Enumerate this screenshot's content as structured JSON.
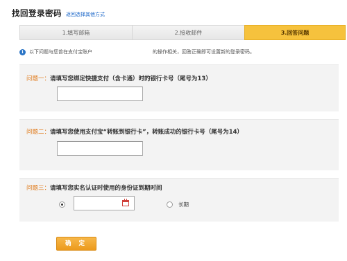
{
  "header": {
    "title": "找回登录密码",
    "switch_link": "返回选择其他方式"
  },
  "steps": [
    {
      "label": "1.填写邮箱",
      "active": false
    },
    {
      "label": "2.接收邮件",
      "active": false
    },
    {
      "label": "3.回答问题",
      "active": true
    }
  ],
  "info": {
    "icon": "info-icon",
    "text_a": "以下问题与您曾在支付宝账户",
    "text_b": "的操作相关，回答正确即可设置新的登录密码。"
  },
  "questions": [
    {
      "number": "问题一：",
      "text": "请填写您绑定快捷支付（含卡通）时的银行卡号（尾号为13）",
      "value": "",
      "placeholder": ""
    },
    {
      "number": "问题二：",
      "text": "请填写您使用支付宝“转账到银行卡”，转账成功的银行卡号（尾号为14）",
      "value": "",
      "placeholder": ""
    },
    {
      "number": "问题三：",
      "text": "请填写您实名认证时使用的身份证到期时间",
      "date_value": "",
      "long_term_label": "长期",
      "selected": "date"
    }
  ],
  "confirm_button": "确 定",
  "colors": {
    "accent": "#f6c23d",
    "button": "#ec9a1c",
    "question_number": "#e07a1a",
    "link": "#1a66c8"
  }
}
